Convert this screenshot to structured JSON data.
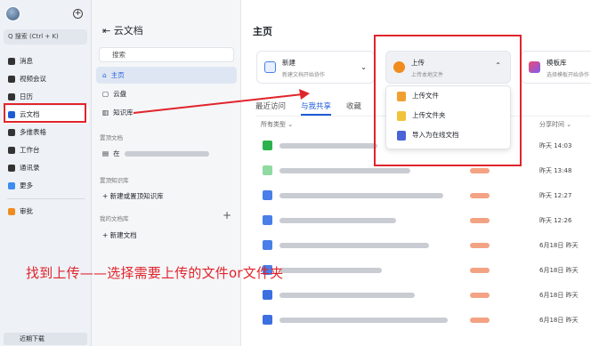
{
  "sidebar": {
    "search_placeholder": "Q 搜索 (Ctrl + K)",
    "items": [
      {
        "label": "消息",
        "icon": "message-icon"
      },
      {
        "label": "视频会议",
        "icon": "video-icon"
      },
      {
        "label": "日历",
        "icon": "calendar-icon"
      },
      {
        "label": "云文档",
        "icon": "cloud-doc-icon"
      },
      {
        "label": "多维表格",
        "icon": "grid-table-icon"
      },
      {
        "label": "工作台",
        "icon": "workbench-icon"
      },
      {
        "label": "通讯录",
        "icon": "contacts-icon"
      },
      {
        "label": "更多",
        "icon": "more-icon"
      },
      {
        "label": "审批",
        "icon": "approval-icon"
      }
    ],
    "recent_download": "近期下载"
  },
  "doc_nav": {
    "title": "云文档",
    "search_placeholder": "搜索",
    "items": [
      {
        "label": "主页",
        "icon": "home-icon"
      },
      {
        "label": "云盘",
        "icon": "cloud-drive-icon"
      },
      {
        "label": "知识库",
        "icon": "knowledge-base-icon"
      }
    ],
    "pinned_docs_header": "置顶文档",
    "pinned_doc_prefix": "在",
    "pinned_kb_header": "置顶知识库",
    "new_pinned_kb": "+ 新建或置顶知识库",
    "my_library_header": "我的文档库",
    "new_doc": "+ 新建文档"
  },
  "main": {
    "title": "主页",
    "cards": [
      {
        "title": "新建",
        "desc": "新建文档开始协作"
      },
      {
        "title": "上传",
        "desc": "上传本地文件"
      },
      {
        "title": "模板库",
        "desc": "选择模板开始协作"
      }
    ],
    "upload_menu": [
      "上传文件",
      "上传文件夹",
      "导入为在线文档"
    ],
    "tabs": [
      "最近访问",
      "与我共享",
      "收藏"
    ],
    "filter_label": "所有类型",
    "time_header": "分享时间",
    "rows": [
      {
        "time": "昨天 14:03",
        "color": "#2bb24c"
      },
      {
        "time": "昨天 13:48",
        "color": "#8fdaa0"
      },
      {
        "time": "昨天 12:27",
        "color": "#4a7ee8"
      },
      {
        "time": "昨天 12:26",
        "color": "#4a7ee8"
      },
      {
        "time": "6月18日 昨天",
        "color": "#4a7ee8"
      },
      {
        "time": "6月18日 昨天",
        "color": "#4a7ee8"
      },
      {
        "time": "6月18日 昨天",
        "color": "#3c6fe0"
      },
      {
        "time": "6月18日 昨天",
        "color": "#3c6fe0"
      }
    ]
  },
  "annotation": {
    "caption": "找到上传——选择需要上传的文件or文件夹",
    "color": "#e0242b"
  }
}
